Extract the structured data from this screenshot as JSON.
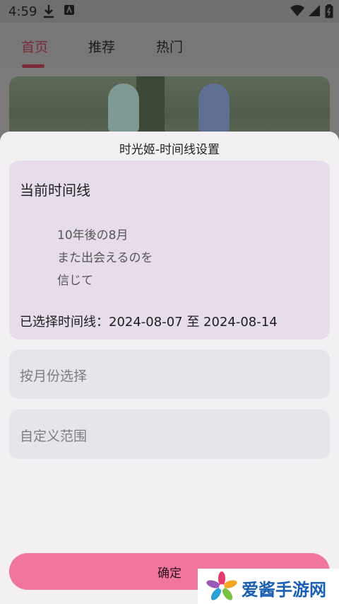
{
  "status_bar": {
    "time": "4:59"
  },
  "tabs": [
    {
      "label": "首页",
      "active": true
    },
    {
      "label": "推荐",
      "active": false
    },
    {
      "label": "热门",
      "active": false
    }
  ],
  "sheet": {
    "title": "时光姬-时间线设置",
    "current_timeline": {
      "heading": "当前时间线",
      "quote_lines": [
        "10年後の8月",
        "また出会えるのを",
        "信じて"
      ],
      "selected_text": "已选择时间线：2024-08-07 至 2024-08-14"
    },
    "options": [
      {
        "label": "按月份选择"
      },
      {
        "label": "自定义范围"
      }
    ],
    "confirm_label": "确定"
  },
  "watermark": {
    "text": "爱酱手游网"
  },
  "colors": {
    "accent": "#f0769b",
    "card_current_bg": "#e6dcea",
    "option_bg": "#e8e5ea",
    "sheet_bg": "#f2f0f3"
  }
}
